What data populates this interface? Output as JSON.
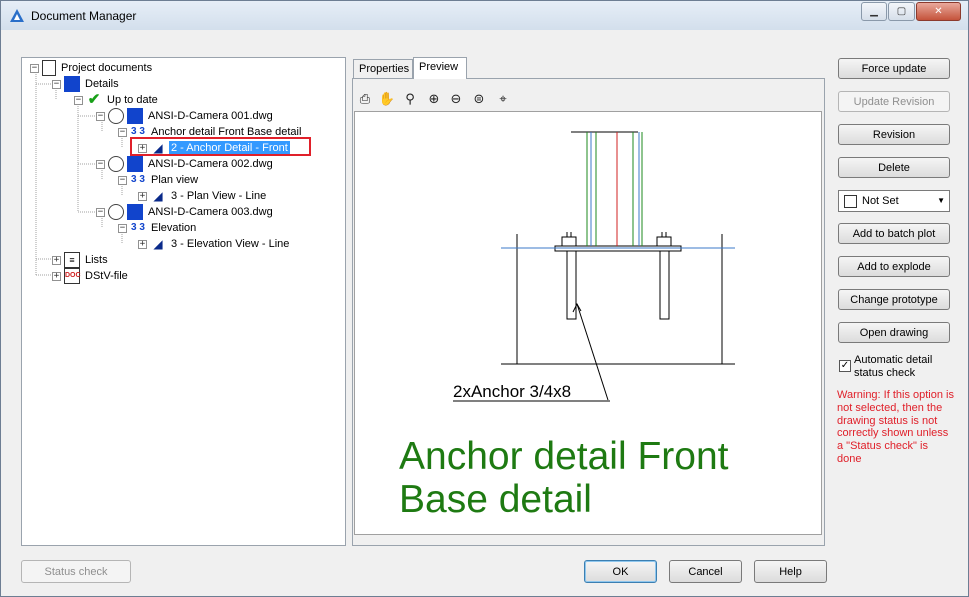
{
  "window": {
    "title": "Document Manager"
  },
  "tree": {
    "root": "Project documents",
    "details": "Details",
    "up_to_date": "Up to date",
    "dwg1": "ANSI-D-Camera 001.dwg",
    "dwg1_detail": "Anchor detail Front Base detail",
    "dwg1_view": "2 - Anchor Detail - Front",
    "dwg2": "ANSI-D-Camera 002.dwg",
    "dwg2_detail": "Plan view",
    "dwg2_view": "3 - Plan View - Line",
    "dwg3": "ANSI-D-Camera 003.dwg",
    "dwg3_detail": "Elevation",
    "dwg3_view": "3 - Elevation View - Line",
    "lists": "Lists",
    "dstv": "DStV-file"
  },
  "tabs": {
    "properties": "Properties",
    "preview": "Preview"
  },
  "preview": {
    "anchor_label": "2xAnchor 3/4x8",
    "title_line1": "Anchor detail Front",
    "title_line2": "Base detail"
  },
  "buttons": {
    "force_update": "Force update",
    "update_revision": "Update Revision",
    "revision": "Revision",
    "delete": "Delete",
    "add_batch_plot": "Add to batch plot",
    "add_explode": "Add to explode",
    "change_prototype": "Change prototype",
    "open_drawing": "Open drawing",
    "status_check": "Status check",
    "ok": "OK",
    "cancel": "Cancel",
    "help": "Help"
  },
  "status_select": {
    "value": "Not Set"
  },
  "auto_check": {
    "label": "Automatic detail status check",
    "checked": true
  },
  "warning": "Warning: If this option is not selected, then the drawing status is not correctly shown unless a \"Status check\" is done",
  "colors": {
    "warning": "#e0202a",
    "selection": "#3399ff",
    "drawing_green": "#1e7a12"
  }
}
